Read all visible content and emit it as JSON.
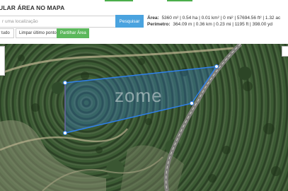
{
  "header": {
    "title": "ULAR ÁREA NO MAPA"
  },
  "search": {
    "placeholder": "r uma localização",
    "button_label": "Pesquisar"
  },
  "measurements": {
    "area_label": "Área:",
    "area_value": "5360 m² | 0.54 ha | 0.01 km² | 0 mi² | 57694.56 ft² | 1.32 ac",
    "perimeter_label": "Perímetro:",
    "perimeter_value": "364.09 m | 0.36 km | 0.23 mi | 1195 ft | 398.00 yd"
  },
  "actions": {
    "clear_label": "r tudo",
    "undo_label": "Limpar último ponto",
    "share_label": "Partilhar Área"
  },
  "map": {
    "watermark": "zome"
  },
  "colors": {
    "accent_green": "#5cb85c",
    "search_blue": "#4aa3df",
    "polygon_stroke": "#2f80ed"
  }
}
